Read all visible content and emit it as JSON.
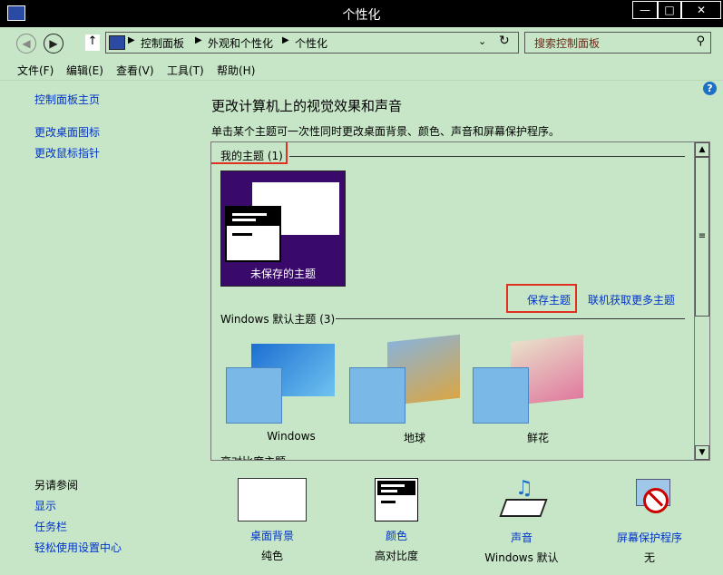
{
  "window": {
    "title": "个性化",
    "minimize": "—",
    "maximize": "□",
    "close": "✕"
  },
  "address": {
    "breadcrumb": [
      "控制面板",
      "外观和个性化",
      "个性化"
    ],
    "search_placeholder": "搜索控制面板"
  },
  "menu": [
    "文件(F)",
    "编辑(E)",
    "查看(V)",
    "工具(T)",
    "帮助(H)"
  ],
  "sidebar": {
    "top_links": [
      "控制面板主页",
      "更改桌面图标",
      "更改鼠标指针"
    ],
    "see_also_title": "另请参阅",
    "see_also_links": [
      "显示",
      "任务栏",
      "轻松使用设置中心"
    ]
  },
  "main": {
    "heading": "更改计算机上的视觉效果和声音",
    "description": "单击某个主题可一次性同时更改桌面背景、颜色、声音和屏幕保护程序。",
    "my_themes": {
      "title": "我的主题 (1)",
      "unsaved_label": "未保存的主题"
    },
    "save_theme": "保存主题",
    "get_more": "联机获取更多主题",
    "default_themes": {
      "title": "Windows 默认主题 (3)",
      "items": [
        "Windows",
        "地球",
        "鲜花"
      ]
    },
    "cut_section": "高对比度主题"
  },
  "bottom": {
    "desktop_bg": {
      "label": "桌面背景",
      "value": "纯色"
    },
    "color": {
      "label": "颜色",
      "value": "高对比度"
    },
    "sound": {
      "label": "声音",
      "value": "Windows 默认"
    },
    "screensaver": {
      "label": "屏幕保护程序",
      "value": "无"
    }
  },
  "help_icon": "?",
  "colors": {
    "background": "#c7e6c7",
    "link": "#0033cc",
    "titlebar": "#000000",
    "highlight_box": "#e03020",
    "theme_purple": "#3a0a6b"
  }
}
